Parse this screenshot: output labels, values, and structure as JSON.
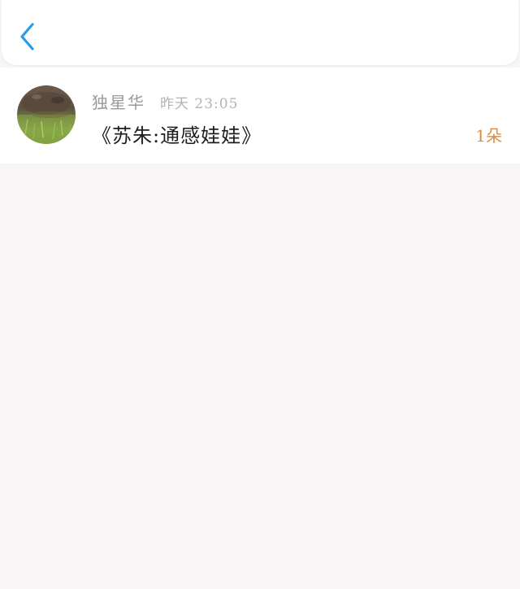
{
  "header": {
    "back_icon": "chevron-left-icon",
    "accent_color": "#2a9be8"
  },
  "item": {
    "avatar_icon": "avatar-photo",
    "username": "独星华",
    "time": "昨天 23:05",
    "title": "《苏朱:通感娃娃》",
    "count": "1朵",
    "count_color": "#e1893e"
  }
}
